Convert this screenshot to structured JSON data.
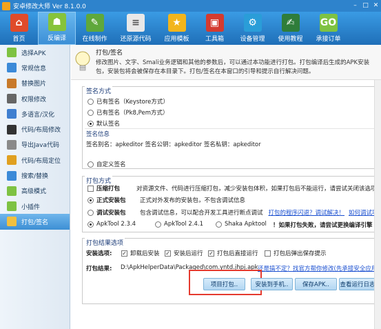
{
  "window": {
    "title": "安卓修改大师 Ver 8.1.0.0",
    "min": "–",
    "max": "□",
    "close": "✕"
  },
  "toolbar": [
    {
      "label": "首页",
      "icon": "home-icon",
      "color": "#e04b2a",
      "glyph": "⌂"
    },
    {
      "label": "反编译",
      "icon": "android-icon",
      "color": "#86c33b",
      "glyph": "☗",
      "active": true
    },
    {
      "label": "在线制作",
      "icon": "online-make-icon",
      "color": "#5fa83b",
      "glyph": "✎"
    },
    {
      "label": "还原源代码",
      "icon": "source-code-icon",
      "color": "#e8e8e8",
      "glyph": "≡"
    },
    {
      "label": "应用模板",
      "icon": "template-icon",
      "color": "#f2b51c",
      "glyph": "★"
    },
    {
      "label": "工具箱",
      "icon": "toolbox-icon",
      "color": "#d43b2f",
      "glyph": "▣"
    },
    {
      "label": "设备管理",
      "icon": "device-manage-icon",
      "color": "#2a9dd8",
      "glyph": "⚙"
    },
    {
      "label": "使用教程",
      "icon": "tutorial-icon",
      "color": "#2f7d3a",
      "glyph": "✍"
    },
    {
      "label": "承接订单",
      "icon": "order-icon",
      "color": "#7ec242",
      "glyph": "GO"
    }
  ],
  "sidebar": [
    {
      "label": "选择APK",
      "icon": "select-apk-icon",
      "color": "#7ec242"
    },
    {
      "label": "常规信息",
      "icon": "info-icon",
      "color": "#3b8ad8"
    },
    {
      "label": "替换图片",
      "icon": "image-icon",
      "color": "#c87a2a"
    },
    {
      "label": "权限修改",
      "icon": "permission-icon",
      "color": "#666666"
    },
    {
      "label": "多语言/汉化",
      "icon": "language-icon",
      "color": "#3f7fd0"
    },
    {
      "label": "代码/布局修改",
      "icon": "code-edit-icon",
      "color": "#333333"
    },
    {
      "label": "导出Java代码",
      "icon": "java-export-icon",
      "color": "#8a8a8a"
    },
    {
      "label": "代码/布局定位",
      "icon": "locate-icon",
      "color": "#e0a020"
    },
    {
      "label": "搜索/替换",
      "icon": "search-icon",
      "color": "#3b8ad8"
    },
    {
      "label": "高级模式",
      "icon": "advanced-icon",
      "color": "#7ec242"
    },
    {
      "label": "小插件",
      "icon": "plugin-icon",
      "color": "#7ec242"
    },
    {
      "label": "打包/签名",
      "icon": "package-icon",
      "color": "#f0c040",
      "active": true
    }
  ],
  "header": {
    "title": "打包/签名",
    "desc": "修改图片、文字、Smali业务逻辑和其他的参数后，可以通过本功能进行打包。打包编译后生成的APK安装包，安装包将会被保存在本目录下。打包/签名在本窗口的引导和提示自行解决问题。"
  },
  "sign": {
    "title": "签名方式",
    "opt1": "已有签名（Keystore方式）",
    "opt2": "已有签名（Pk8,Pem方式）",
    "opt3": "默认签名",
    "info_title": "签名信息",
    "info_text": "签名别名：apkeditor   签名公钥：apkeditor   签名私钥：apkeditor",
    "custom": "自定义签名"
  },
  "pack": {
    "title": "打包方式",
    "compress_label": "压缩打包",
    "compress_desc": "对资源文件、代码进行压缩打包，减少安装包体积，如果打包后不能运行，请尝试关闭该选项",
    "release_label": "正式安装包",
    "release_desc": "正式对外发布的安装包，不包含调试信息",
    "debug_label": "调试安装包",
    "debug_desc": "包含调试信息，可以配合开发工具进行断点调试",
    "debug_link1": "打包的程序闪退？调试解决！",
    "debug_link2": "如何调试项目资源",
    "tool1": "ApkTool 2.3.4",
    "tool2": "ApkTool 2.4.1",
    "tool3": "Shaka Apktool",
    "tool_tip": "！如果打包失败，请尝试更换编译引擎"
  },
  "result": {
    "title": "打包结果选项",
    "install_label": "安装选项:",
    "opt1": "卸载后安装",
    "opt2": "安装后运行",
    "opt3": "打包后直接运行",
    "opt4": "打包后弹出保存提示",
    "path_label": "打包结果:",
    "path": "D:\\ApkHelperData\\Packaged\\com.yntd.jhpj.apk",
    "help_link": "还是搞不定？找官方帮你修改(先承接安全应用和游",
    "btn_pack": "项目打包..",
    "btn_install": "安装到手机..",
    "btn_save": "保存APK..",
    "btn_log": "查看运行日志"
  }
}
